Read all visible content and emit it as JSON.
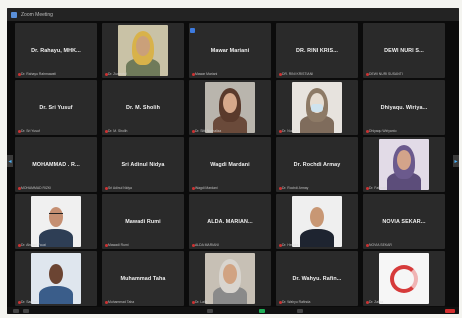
{
  "window": {
    "title": "Zoom Meeting"
  },
  "tiles": [
    {
      "name": "Dr. Rahayu, MHK...",
      "label": "Dr. Rahayu Rahmawati",
      "photo": false
    },
    {
      "name": "",
      "label": "Dr. Zumrotul",
      "photo": true,
      "photo_kind": "woman-yellow"
    },
    {
      "name": "Mawar Mariani",
      "label": "Mawar Mariani",
      "photo": false
    },
    {
      "name": "DR. RINI KRIS...",
      "label": "DR. RINI KRISTIANI",
      "photo": false
    },
    {
      "name": "DEWI NURI S...",
      "label": "DEWI NURI SUSANTI",
      "photo": false
    },
    {
      "name": "Dr. Sri Yusuf",
      "label": "Dr. Sri Yusuf",
      "photo": false
    },
    {
      "name": "Dr. M. Sholih",
      "label": "Dr. M. Sholih",
      "photo": false
    },
    {
      "name": "",
      "label": "Dr. Sitti Nurhaliza",
      "photo": true,
      "photo_kind": "woman-hijab-dark"
    },
    {
      "name": "",
      "label": "Dr. Nur Aini",
      "photo": true,
      "photo_kind": "woman-mask"
    },
    {
      "name": "Dhiyaqu. Wiriya...",
      "label": "Dhiyaqu Wiriyanto",
      "photo": false
    },
    {
      "name": "MOHAMMAD . R...",
      "label": "MOHAMMAD RIZKI",
      "photo": false
    },
    {
      "name": "Sri Adinul Nidya",
      "label": "Sri Adinul Nidya",
      "photo": false
    },
    {
      "name": "Wagdi Mardani",
      "label": "Wagdi Mardani",
      "photo": false
    },
    {
      "name": "Dr. Rochdi Armay",
      "label": "Dr. Rochdi Armay",
      "photo": false
    },
    {
      "name": "",
      "label": "Dr. Fatimah",
      "photo": true,
      "photo_kind": "woman-hijab-purple"
    },
    {
      "name": "",
      "label": "Dr. Ahmad Fauzi",
      "photo": true,
      "photo_kind": "man-glasses"
    },
    {
      "name": "Mawadi Rumi",
      "label": "Mawadi Rumi",
      "photo": false
    },
    {
      "name": "ALDA. MARIAN...",
      "label": "ALDA MARIANI",
      "photo": false
    },
    {
      "name": "",
      "label": "Dr. Hendra",
      "photo": true,
      "photo_kind": "man-suit"
    },
    {
      "name": "NOVIA SEKAR...",
      "label": "NOVIA SEKAR",
      "photo": false
    },
    {
      "name": "",
      "label": "Dr. Samuel",
      "photo": true,
      "photo_kind": "man-dark"
    },
    {
      "name": "Muhammad Taha",
      "label": "Muhammad Taha",
      "photo": false
    },
    {
      "name": "",
      "label": "Dr. Laila",
      "photo": true,
      "photo_kind": "woman-hijab-light"
    },
    {
      "name": "Dr. Wahyu. Rafin...",
      "label": "Dr. Wahyu Rafinda",
      "photo": false
    },
    {
      "name": "",
      "label": "Dr. Zahra",
      "photo": true,
      "photo_kind": "logo-red"
    }
  ],
  "colors": {
    "tile_bg": "#2a2a2a",
    "window_bg": "#0b0b0b",
    "accent": "#3d7be0",
    "end_button": "#d32f2f",
    "video_on": "#1fae57"
  },
  "icons": {
    "prev_page": "chevron-left-icon",
    "next_page": "chevron-right-icon",
    "app": "zoom-icon"
  }
}
